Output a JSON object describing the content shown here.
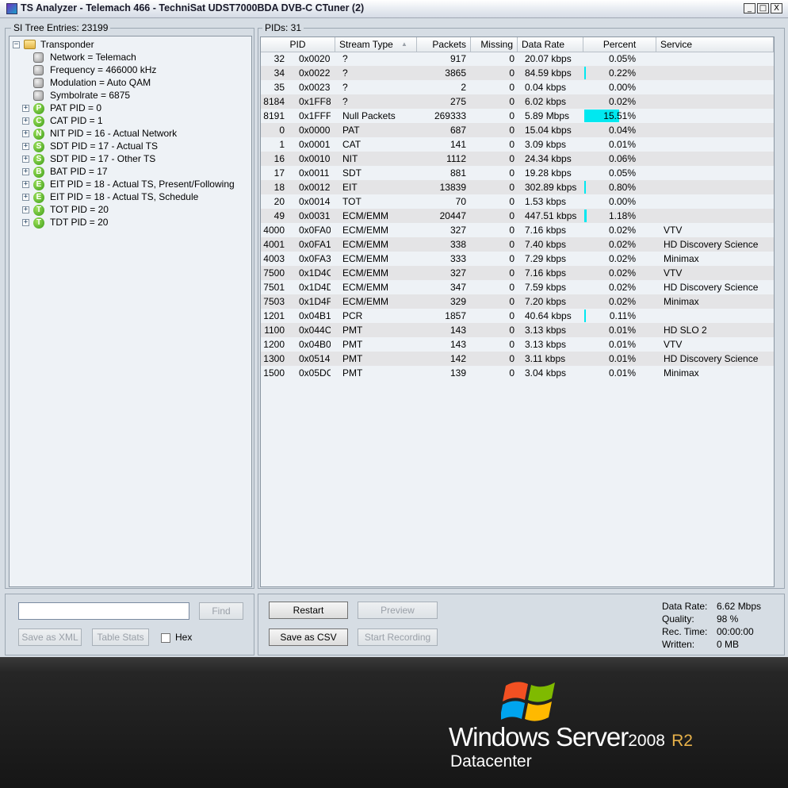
{
  "window": {
    "title": "TS Analyzer - Telemach 466 - TechniSat UDST7000BDA DVB-C CTuner (2)",
    "minimize": "_",
    "maximize": "□",
    "close": "X"
  },
  "si_tree": {
    "header": "SI Tree Entries: 23199",
    "items": [
      {
        "label": "Transponder",
        "icon": "folder-icon",
        "expander": "−"
      },
      {
        "label": "Network = Telemach",
        "icon": "property-icon"
      },
      {
        "label": "Frequency = 466000 kHz",
        "icon": "property-icon"
      },
      {
        "label": "Modulation = Auto QAM",
        "icon": "property-icon"
      },
      {
        "label": "Symbolrate = 6875",
        "icon": "property-icon"
      },
      {
        "label": "PAT PID = 0",
        "icon_letter": "P",
        "expander": "+"
      },
      {
        "label": "CAT PID = 1",
        "icon_letter": "C",
        "expander": "+"
      },
      {
        "label": "NIT PID = 16 - Actual Network",
        "icon_letter": "N",
        "expander": "+"
      },
      {
        "label": "SDT PID = 17 - Actual TS",
        "icon_letter": "S",
        "expander": "+"
      },
      {
        "label": "SDT PID = 17 - Other TS",
        "icon_letter": "S",
        "expander": "+"
      },
      {
        "label": "BAT PID = 17",
        "icon_letter": "B",
        "expander": "+"
      },
      {
        "label": "EIT PID = 18 - Actual TS, Present/Following",
        "icon_letter": "E",
        "expander": "+"
      },
      {
        "label": "EIT PID = 18 - Actual TS, Schedule",
        "icon_letter": "E",
        "expander": "+"
      },
      {
        "label": "TOT PID = 20",
        "icon_letter": "T",
        "expander": "+"
      },
      {
        "label": "TDT PID = 20",
        "icon_letter": "T",
        "expander": "+"
      }
    ],
    "find_placeholder": "",
    "find_button": "Find",
    "save_xml_button": "Save as XML",
    "table_stats_button": "Table Stats",
    "hex_label": "Hex"
  },
  "pids": {
    "header": "PIDs: 31",
    "columns": [
      "PID",
      "Stream Type",
      "Packets",
      "Missing",
      "Data Rate",
      "Percent",
      "Service"
    ],
    "sort_indicator": "▲",
    "bar_color": "#00e8f0",
    "rows": [
      {
        "pid": "32",
        "hex": "0x0020",
        "type": "?",
        "packets": "917",
        "missing": "0",
        "rate": "20.07 kbps",
        "percent": "0.05%",
        "pct": 0.05,
        "service": ""
      },
      {
        "pid": "34",
        "hex": "0x0022",
        "type": "?",
        "packets": "3865",
        "missing": "0",
        "rate": "84.59 kbps",
        "percent": "0.22%",
        "pct": 0.22,
        "service": ""
      },
      {
        "pid": "35",
        "hex": "0x0023",
        "type": "?",
        "packets": "2",
        "missing": "0",
        "rate": "0.04 kbps",
        "percent": "0.00%",
        "pct": 0,
        "service": ""
      },
      {
        "pid": "8184",
        "hex": "0x1FF8",
        "type": "?",
        "packets": "275",
        "missing": "0",
        "rate": "6.02 kbps",
        "percent": "0.02%",
        "pct": 0.02,
        "service": ""
      },
      {
        "pid": "8191",
        "hex": "0x1FFF",
        "type": "Null Packets",
        "packets": "269333",
        "missing": "0",
        "rate": "5.89 Mbps",
        "percent": "15.51%",
        "pct": 15.51,
        "service": ""
      },
      {
        "pid": "0",
        "hex": "0x0000",
        "type": "PAT",
        "packets": "687",
        "missing": "0",
        "rate": "15.04 kbps",
        "percent": "0.04%",
        "pct": 0.04,
        "service": ""
      },
      {
        "pid": "1",
        "hex": "0x0001",
        "type": "CAT",
        "packets": "141",
        "missing": "0",
        "rate": "3.09 kbps",
        "percent": "0.01%",
        "pct": 0.01,
        "service": ""
      },
      {
        "pid": "16",
        "hex": "0x0010",
        "type": "NIT",
        "packets": "1112",
        "missing": "0",
        "rate": "24.34 kbps",
        "percent": "0.06%",
        "pct": 0.06,
        "service": ""
      },
      {
        "pid": "17",
        "hex": "0x0011",
        "type": "SDT",
        "packets": "881",
        "missing": "0",
        "rate": "19.28 kbps",
        "percent": "0.05%",
        "pct": 0.05,
        "service": ""
      },
      {
        "pid": "18",
        "hex": "0x0012",
        "type": "EIT",
        "packets": "13839",
        "missing": "0",
        "rate": "302.89 kbps",
        "percent": "0.80%",
        "pct": 0.8,
        "service": ""
      },
      {
        "pid": "20",
        "hex": "0x0014",
        "type": "TOT",
        "packets": "70",
        "missing": "0",
        "rate": "1.53 kbps",
        "percent": "0.00%",
        "pct": 0,
        "service": ""
      },
      {
        "pid": "49",
        "hex": "0x0031",
        "type": "ECM/EMM",
        "packets": "20447",
        "missing": "0",
        "rate": "447.51 kbps",
        "percent": "1.18%",
        "pct": 1.18,
        "service": ""
      },
      {
        "pid": "4000",
        "hex": "0x0FA0",
        "type": "ECM/EMM",
        "packets": "327",
        "missing": "0",
        "rate": "7.16 kbps",
        "percent": "0.02%",
        "pct": 0.02,
        "service": "VTV"
      },
      {
        "pid": "4001",
        "hex": "0x0FA1",
        "type": "ECM/EMM",
        "packets": "338",
        "missing": "0",
        "rate": "7.40 kbps",
        "percent": "0.02%",
        "pct": 0.02,
        "service": "HD Discovery Science"
      },
      {
        "pid": "4003",
        "hex": "0x0FA3",
        "type": "ECM/EMM",
        "packets": "333",
        "missing": "0",
        "rate": "7.29 kbps",
        "percent": "0.02%",
        "pct": 0.02,
        "service": "Minimax"
      },
      {
        "pid": "7500",
        "hex": "0x1D4C",
        "type": "ECM/EMM",
        "packets": "327",
        "missing": "0",
        "rate": "7.16 kbps",
        "percent": "0.02%",
        "pct": 0.02,
        "service": "VTV"
      },
      {
        "pid": "7501",
        "hex": "0x1D4D",
        "type": "ECM/EMM",
        "packets": "347",
        "missing": "0",
        "rate": "7.59 kbps",
        "percent": "0.02%",
        "pct": 0.02,
        "service": "HD Discovery Science"
      },
      {
        "pid": "7503",
        "hex": "0x1D4F",
        "type": "ECM/EMM",
        "packets": "329",
        "missing": "0",
        "rate": "7.20 kbps",
        "percent": "0.02%",
        "pct": 0.02,
        "service": "Minimax"
      },
      {
        "pid": "1201",
        "hex": "0x04B1",
        "type": "PCR",
        "packets": "1857",
        "missing": "0",
        "rate": "40.64 kbps",
        "percent": "0.11%",
        "pct": 0.11,
        "service": ""
      },
      {
        "pid": "1100",
        "hex": "0x044C",
        "type": "PMT",
        "packets": "143",
        "missing": "0",
        "rate": "3.13 kbps",
        "percent": "0.01%",
        "pct": 0.01,
        "service": "HD SLO 2"
      },
      {
        "pid": "1200",
        "hex": "0x04B0",
        "type": "PMT",
        "packets": "143",
        "missing": "0",
        "rate": "3.13 kbps",
        "percent": "0.01%",
        "pct": 0.01,
        "service": "VTV"
      },
      {
        "pid": "1300",
        "hex": "0x0514",
        "type": "PMT",
        "packets": "142",
        "missing": "0",
        "rate": "3.11 kbps",
        "percent": "0.01%",
        "pct": 0.01,
        "service": "HD Discovery Science"
      },
      {
        "pid": "1500",
        "hex": "0x05DC",
        "type": "PMT",
        "packets": "139",
        "missing": "0",
        "rate": "3.04 kbps",
        "percent": "0.01%",
        "pct": 0.01,
        "service": "Minimax"
      }
    ],
    "restart_button": "Restart",
    "preview_button": "Preview",
    "save_csv_button": "Save as CSV",
    "start_recording_button": "Start Recording"
  },
  "stats": {
    "data_rate_label": "Data Rate:",
    "data_rate_value": "6.62 Mbps",
    "quality_label": "Quality:",
    "quality_value": "98 %",
    "rec_time_label": "Rec. Time:",
    "rec_time_value": "00:00:00",
    "written_label": "Written:",
    "written_value": "0 MB"
  },
  "desktop": {
    "brand": "Windows Server",
    "version": "2008",
    "release": "R2",
    "edition": "Datacenter"
  }
}
